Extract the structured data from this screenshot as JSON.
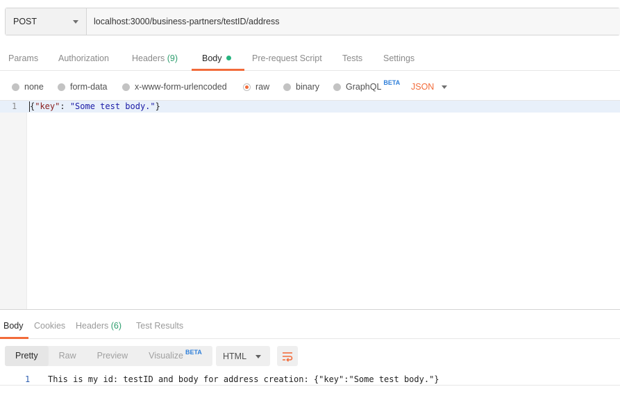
{
  "request": {
    "method": "POST",
    "url": "localhost:3000/business-partners/testID/address"
  },
  "request_tabs": {
    "params": "Params",
    "authorization": "Authorization",
    "headers": "Headers",
    "headers_count": "(9)",
    "body": "Body",
    "prerequest": "Pre-request Script",
    "tests": "Tests",
    "settings": "Settings"
  },
  "body_types": {
    "none": "none",
    "form_data": "form-data",
    "urlencoded": "x-www-form-urlencoded",
    "raw": "raw",
    "binary": "binary",
    "graphql": "GraphQL",
    "beta": "BETA",
    "selected": "raw",
    "format": "JSON"
  },
  "editor": {
    "line_number": "1",
    "open_brace": "{",
    "key": "\"key\"",
    "colon": ": ",
    "value": "\"Some test body.\"",
    "close_brace": "}"
  },
  "response_tabs": {
    "body": "Body",
    "cookies": "Cookies",
    "headers": "Headers",
    "headers_count": "(6)",
    "test_results": "Test Results"
  },
  "response_view": {
    "pretty": "Pretty",
    "raw": "Raw",
    "preview": "Preview",
    "visualize": "Visualize",
    "beta": "BETA",
    "format": "HTML"
  },
  "response_body": {
    "line_number": "1",
    "text": "This is my id: testID and body for address creation: {\"key\":\"Some test body.\"}"
  },
  "colors": {
    "accent": "#f26b3a",
    "beta": "#2f7fd9",
    "count": "#2e9e6e",
    "active_dot": "#26b47f"
  }
}
